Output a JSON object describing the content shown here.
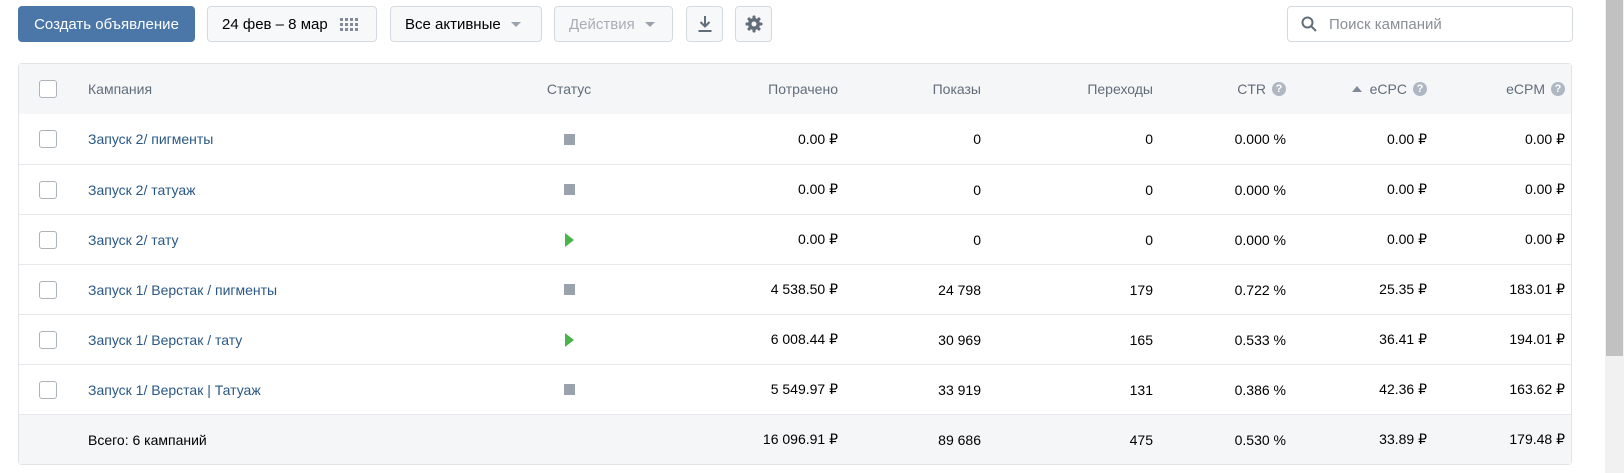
{
  "toolbar": {
    "create_label": "Создать объявление",
    "date_range": "24 фев – 8 мар",
    "filter_label": "Все активные",
    "actions_label": "Действия",
    "search_placeholder": "Поиск кампаний"
  },
  "table": {
    "headers": {
      "campaign": "Кампания",
      "status": "Статус",
      "spent": "Потрачено",
      "shows": "Показы",
      "clicks": "Переходы",
      "ctr": "CTR",
      "ecpc": "eCPC",
      "ecpm": "eCPM"
    },
    "rows": [
      {
        "name": "Запуск 2/ пигменты",
        "status": "stopped",
        "spent": "0.00 ₽",
        "shows": "0",
        "clicks": "0",
        "ctr": "0.000 %",
        "ecpc": "0.00 ₽",
        "ecpm": "0.00 ₽"
      },
      {
        "name": "Запуск 2/ татуаж",
        "status": "stopped",
        "spent": "0.00 ₽",
        "shows": "0",
        "clicks": "0",
        "ctr": "0.000 %",
        "ecpc": "0.00 ₽",
        "ecpm": "0.00 ₽"
      },
      {
        "name": "Запуск 2/ тату",
        "status": "running",
        "spent": "0.00 ₽",
        "shows": "0",
        "clicks": "0",
        "ctr": "0.000 %",
        "ecpc": "0.00 ₽",
        "ecpm": "0.00 ₽"
      },
      {
        "name": "Запуск 1/ Верстак / пигменты",
        "status": "stopped",
        "spent": "4 538.50 ₽",
        "shows": "24 798",
        "clicks": "179",
        "ctr": "0.722 %",
        "ecpc": "25.35 ₽",
        "ecpm": "183.01 ₽"
      },
      {
        "name": "Запуск 1/ Верстак / тату",
        "status": "running",
        "spent": "6 008.44 ₽",
        "shows": "30 969",
        "clicks": "165",
        "ctr": "0.533 %",
        "ecpc": "36.41 ₽",
        "ecpm": "194.01 ₽"
      },
      {
        "name": "Запуск 1/ Верстак | Татуаж",
        "status": "stopped",
        "spent": "5 549.97 ₽",
        "shows": "33 919",
        "clicks": "131",
        "ctr": "0.386 %",
        "ecpc": "42.36 ₽",
        "ecpm": "163.62 ₽"
      }
    ],
    "total": {
      "label": "Всего: 6 кампаний",
      "spent": "16 096.91 ₽",
      "shows": "89 686",
      "clicks": "475",
      "ctr": "0.530 %",
      "ecpc": "33.89 ₽",
      "ecpm": "179.48 ₽"
    }
  },
  "colors": {
    "primary": "#4a76a8",
    "link": "#2a5885",
    "running": "#4bb34b",
    "stopped": "#99a2ad"
  }
}
